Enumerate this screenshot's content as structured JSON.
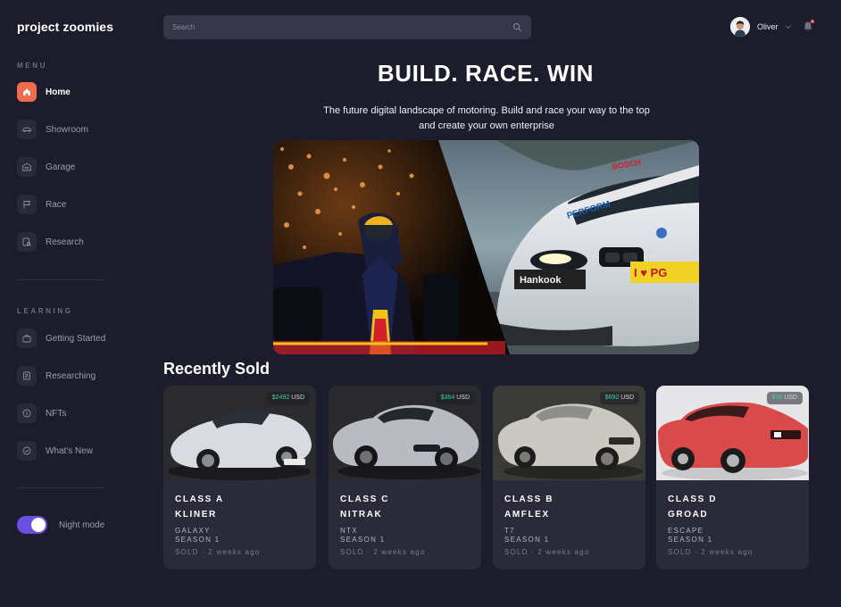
{
  "brand": "project zoomies",
  "sidebar": {
    "menu_label": "MENU",
    "menu_items": [
      {
        "label": "Home",
        "icon": "home-icon",
        "active": true
      },
      {
        "label": "Showroom",
        "icon": "car-icon",
        "active": false
      },
      {
        "label": "Garage",
        "icon": "garage-icon",
        "active": false
      },
      {
        "label": "Race",
        "icon": "flag-icon",
        "active": false
      },
      {
        "label": "Research",
        "icon": "research-icon",
        "active": false
      }
    ],
    "learning_label": "LEARNING",
    "learning_items": [
      {
        "label": "Getting Started",
        "icon": "briefcase-icon"
      },
      {
        "label": "Researching",
        "icon": "document-icon"
      },
      {
        "label": "NFTs",
        "icon": "coin-icon"
      },
      {
        "label": "What's New",
        "icon": "check-badge-icon"
      }
    ],
    "night_mode_label": "Night mode",
    "night_mode_on": true
  },
  "header": {
    "search_placeholder": "Search",
    "user_name": "Oliver"
  },
  "hero": {
    "title": "BUILD. RACE. WIN",
    "subtitle_line1": "The future digital landscape of motoring. Build and race your way to the top",
    "subtitle_line2": "and create your own enterprise"
  },
  "recently_sold": {
    "title": "Recently Sold",
    "cards": [
      {
        "price": "$2492",
        "currency": "USD",
        "class": "CLASS A",
        "name": "KLINER",
        "model": "GALAXY",
        "season": "SEASON 1",
        "sold": "SOLD · 2 weeks ago",
        "color": "#d9dbe0",
        "bg": "#2b2b2e"
      },
      {
        "price": "$364",
        "currency": "USD",
        "class": "CLASS C",
        "name": "NITRAK",
        "model": "NTX",
        "season": "SEASON 1",
        "sold": "SOLD · 2 weeks ago",
        "color": "#b8bbc2",
        "bg": "#2a2a2e"
      },
      {
        "price": "$692",
        "currency": "USD",
        "class": "CLASS B",
        "name": "AMFLEX",
        "model": "T7",
        "season": "SEASON 1",
        "sold": "SOLD · 2 weeks ago",
        "color": "#c9c9c2",
        "bg": "#3a3a36"
      },
      {
        "price": "$56",
        "currency": "USD",
        "class": "CLASS D",
        "name": "GROAD",
        "model": "ESCAPE",
        "season": "SEASON 1",
        "sold": "SOLD · 2 weeks ago",
        "color": "#d94a4a",
        "bg": "#e6e6e8"
      }
    ]
  }
}
